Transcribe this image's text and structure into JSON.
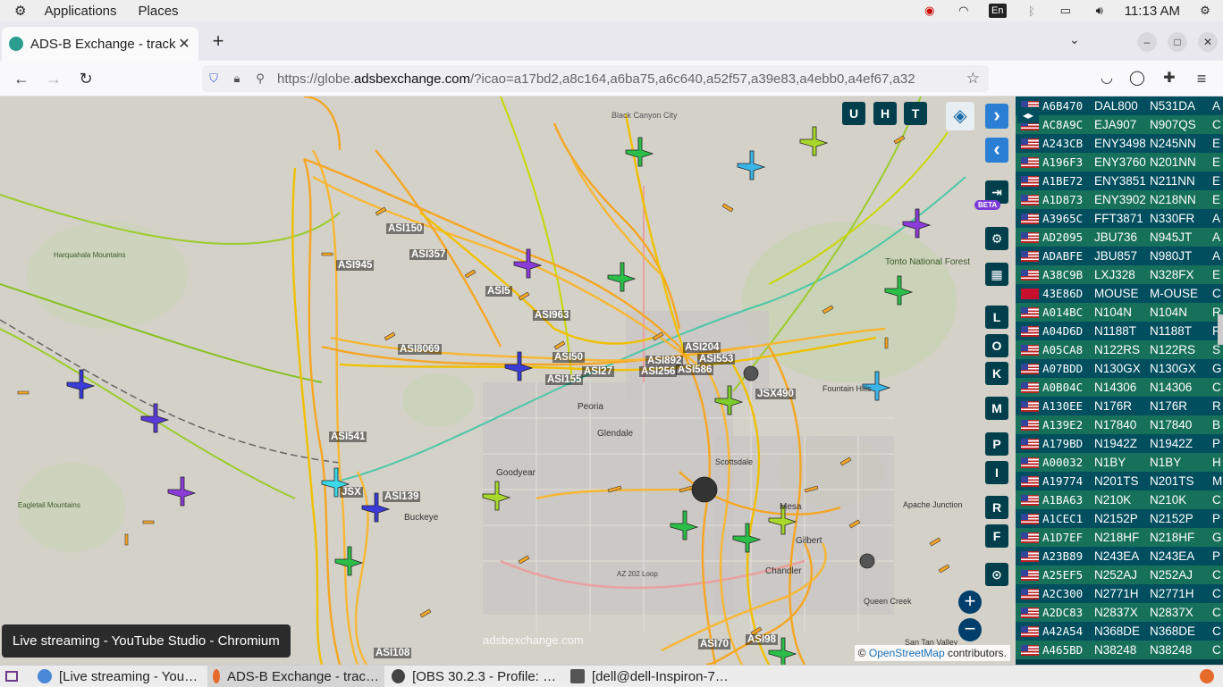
{
  "system_bar": {
    "applications": "Applications",
    "places": "Places",
    "input_lang": "En",
    "clock": "11:13 AM"
  },
  "browser": {
    "tab_title": "ADS-B Exchange - track a",
    "url_prefix": "https://globe.",
    "url_domain": "adsbexchange.com",
    "url_rest": "/?icao=a17bd2,a8c164,a6ba75,a6c640,a52f57,a39e83,a4ebb0,a4ef67,a32"
  },
  "map": {
    "buttons": {
      "u": "U",
      "h": "H",
      "t": "T",
      "l": "L",
      "o": "O",
      "k": "K",
      "m": "M",
      "p": "P",
      "i": "I",
      "r": "R",
      "f": "F"
    },
    "beta": "BETA",
    "place_labels": [
      "Black Canyon City",
      "Peoria",
      "Glendale",
      "Goodyear",
      "Buckeye",
      "Mesa",
      "Gilbert",
      "Chandler",
      "Fountain Hills",
      "Queen Creek",
      "San Tan Valley",
      "Apache Junction",
      "Scottsdale",
      "Tonto National Forest",
      "AZ 202 Loop"
    ],
    "aircraft_labels": [
      "ASI150",
      "ASI357",
      "ASI945",
      "ASI5",
      "ASI963",
      "ASI8069",
      "ASI155",
      "ASI27",
      "ASI256",
      "ASI586",
      "ASI553",
      "ASI204",
      "JSX490",
      "ASI541",
      "ASI139",
      "JSX",
      "ASI70",
      "ASI98",
      "ASI108",
      "ASI50",
      "ASI892"
    ],
    "watermark": "adsbexchange.com",
    "attribution_prefix": "©",
    "attribution_link": "OpenStreetMap",
    "attribution_suffix": "contributors.",
    "tooltip": "Live streaming - YouTube Studio - Chromium"
  },
  "table": {
    "rows": [
      [
        "A6B470",
        "DAL800",
        "N531DA",
        "A",
        "us"
      ],
      [
        "AC8A9C",
        "EJA907",
        "N907QS",
        "C",
        "us"
      ],
      [
        "A243CB",
        "ENY3498",
        "N245NN",
        "E",
        "us"
      ],
      [
        "A196F3",
        "ENY3760",
        "N201NN",
        "E",
        "us"
      ],
      [
        "A1BE72",
        "ENY3851",
        "N211NN",
        "E",
        "us"
      ],
      [
        "A1D873",
        "ENY3902",
        "N218NN",
        "E",
        "us"
      ],
      [
        "A3965C",
        "FFT3871",
        "N330FR",
        "A",
        "us"
      ],
      [
        "AD2095",
        "JBU736",
        "N945JT",
        "A",
        "us"
      ],
      [
        "ADABFE",
        "JBU857",
        "N980JT",
        "A",
        "us"
      ],
      [
        "A38C9B",
        "LXJ328",
        "N328FX",
        "E",
        "us"
      ],
      [
        "43E86D",
        "MOUSE",
        "M-OUSE",
        "C",
        "im"
      ],
      [
        "A014BC",
        "N104N",
        "N104N",
        "R",
        "us"
      ],
      [
        "A04D6D",
        "N1188T",
        "N1188T",
        "F",
        "us"
      ],
      [
        "A05CA8",
        "N122RS",
        "N122RS",
        "S",
        "us"
      ],
      [
        "A07BDD",
        "N130GX",
        "N130GX",
        "G",
        "us"
      ],
      [
        "A0B04C",
        "N14306",
        "N14306",
        "C",
        "us"
      ],
      [
        "A130EE",
        "N176R",
        "N176R",
        "R",
        "us"
      ],
      [
        "A139E2",
        "N17840",
        "N17840",
        "B",
        "us"
      ],
      [
        "A179BD",
        "N1942Z",
        "N1942Z",
        "P",
        "us"
      ],
      [
        "A00032",
        "N1BY",
        "N1BY",
        "H",
        "us"
      ],
      [
        "A19774",
        "N201TS",
        "N201TS",
        "M",
        "us"
      ],
      [
        "A1BA63",
        "N210K",
        "N210K",
        "C",
        "us"
      ],
      [
        "A1CEC1",
        "N2152P",
        "N2152P",
        "P",
        "us"
      ],
      [
        "A1D7EF",
        "N218HF",
        "N218HF",
        "G",
        "us"
      ],
      [
        "A23B89",
        "N243EA",
        "N243EA",
        "P",
        "us"
      ],
      [
        "A25EF5",
        "N252AJ",
        "N252AJ",
        "C",
        "us"
      ],
      [
        "A2C300",
        "N2771H",
        "N2771H",
        "C",
        "us"
      ],
      [
        "A2DC83",
        "N2837X",
        "N2837X",
        "C",
        "us"
      ],
      [
        "A42A54",
        "N368DE",
        "N368DE",
        "C",
        "us"
      ],
      [
        "A465BD",
        "N38248",
        "N38248",
        "C",
        "us"
      ]
    ]
  },
  "taskbar": {
    "items": [
      "[Live streaming - You…",
      "ADS-B Exchange - trac…",
      "[OBS 30.2.3 - Profile: …",
      "[dell@dell-Inspiron-7…"
    ]
  },
  "colors": {
    "track_orange": "#f5a623",
    "track_yellow": "#f0d000",
    "panel_bg": "#003f4b",
    "panel_alt": "#16705a"
  }
}
